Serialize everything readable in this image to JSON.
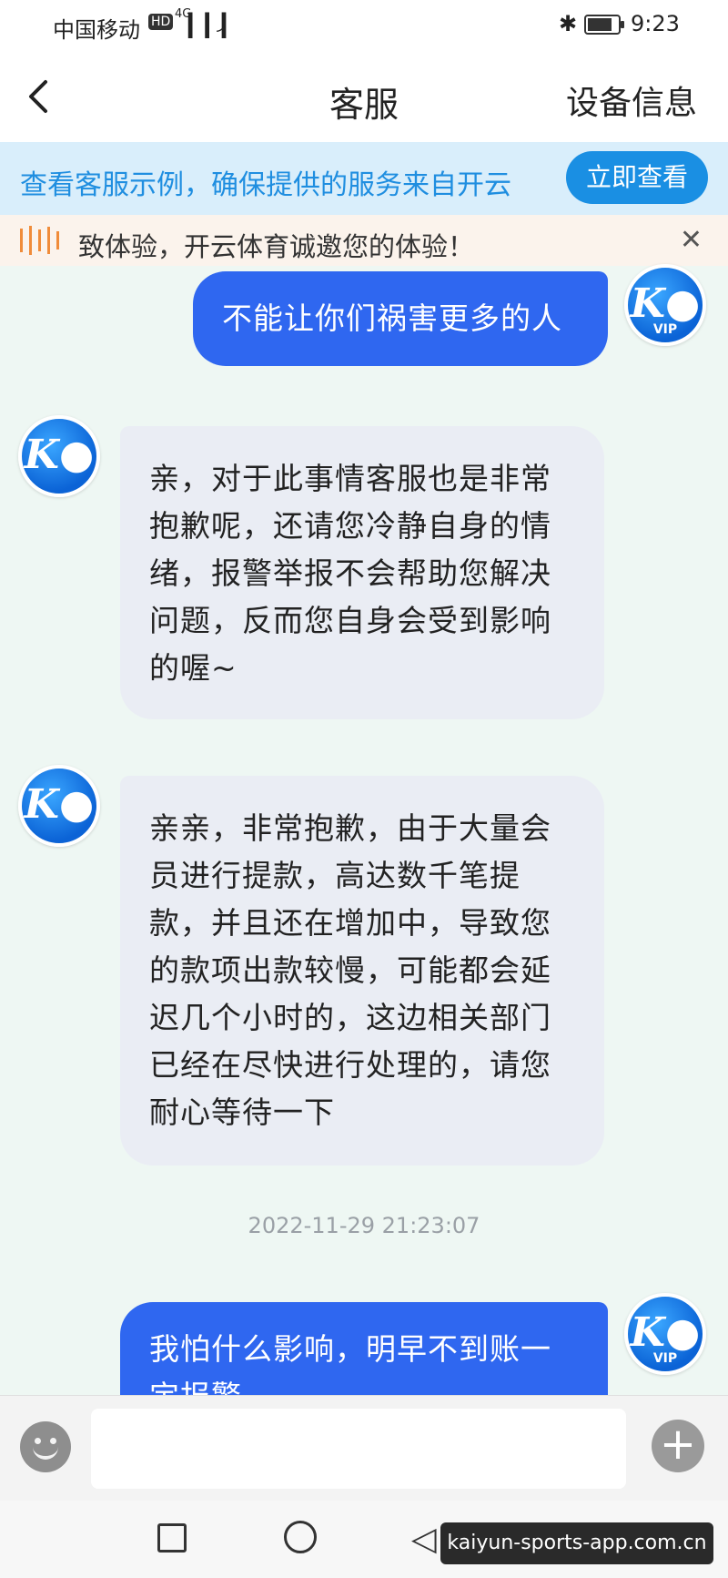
{
  "status_bar": {
    "carrier": "中国移动",
    "hd": "HD",
    "network": "4G",
    "signal": "▎▎▎",
    "wifi": "◞",
    "bluetooth": "✱",
    "battery_level": 0.8,
    "time": "9:23"
  },
  "header": {
    "title": "客服",
    "device_info": "设备信息"
  },
  "banner": {
    "text": "查看客服示例，确保提供的服务来自开云",
    "button": "立即查看"
  },
  "notice": {
    "text": "致体验，开云体育诚邀您的体验！",
    "close": "✕"
  },
  "avatar": {
    "logo": "K●",
    "vip": "VIP"
  },
  "messages": [
    {
      "from": "user",
      "text": "不能让你们祸害更多的人"
    },
    {
      "from": "agent",
      "text": "亲，对于此事情客服也是非常抱歉呢，还请您冷静自身的情绪，报警举报不会帮助您解决问题，反而您自身会受到影响的喔~"
    },
    {
      "from": "agent",
      "text": "亲亲，非常抱歉，由于大量会员进行提款，高达数千笔提款，并且还在增加中，导致您的款项出款较慢，可能都会延迟几个小时的，这边相关部门已经在尽快进行处理的，请您耐心等待一下"
    },
    {
      "from": "user",
      "text": "我怕什么影响，明早不到账一定报警"
    }
  ],
  "timestamp": "2022-11-29 21:23:07",
  "input": {
    "value": "",
    "placeholder": ""
  },
  "watermark": "kaiyun-sports-app.com.cn",
  "colors": {
    "user_bubble": "#2f67f0",
    "agent_bubble": "#eaedf4",
    "banner_bg": "#d9eefb",
    "banner_button": "#1a8fe3",
    "background": "#eef7f3"
  }
}
